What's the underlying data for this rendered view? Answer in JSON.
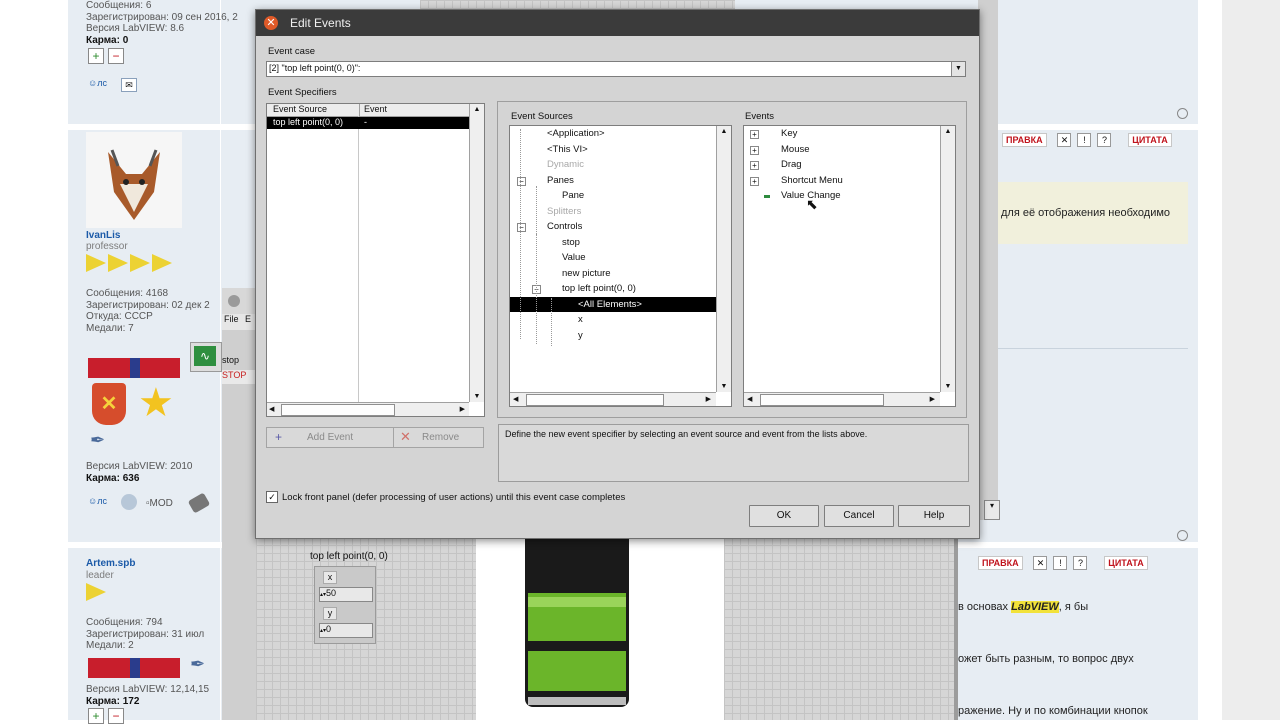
{
  "forum": {
    "post1": {
      "messages": "Сообщения: 6",
      "registered": "Зарегистрирован: 09 сен 2016, 2",
      "version": "Версия LabVIEW: 8.6",
      "karma_label": "Карма: ",
      "karma_value": "0"
    },
    "post2": {
      "username": "IvanLis",
      "rank": "professor",
      "messages": "Сообщения: 4168",
      "registered": "Зарегистрирован: 02 дек 2",
      "from": "Откуда: СССР",
      "medals": "Медали: 7",
      "version": "Версия LabVIEW: 2010",
      "karma_label": "Карма: ",
      "karma_value": "636",
      "right_text": "для её отображения необходимо",
      "mod_label": "MOD"
    },
    "post3": {
      "username": "Artem.spb",
      "rank": "leader",
      "messages": "Сообщения: 794",
      "registered": "Зарегистрирован: 31 июл",
      "medals": "Медали: 2",
      "version": "Версия LabVIEW: 12,14,15",
      "karma_label": "Карма: ",
      "karma_value": "172",
      "line1_pre": "в основах ",
      "line1_highlight": "LabVIEW",
      "line1_post": ", я бы",
      "line2": "ожет быть разным, то вопрос двух",
      "line3": "ражение. Ну и по комбинации кнопок"
    },
    "pm_label": "лс",
    "edit_label": "ПРАВКА",
    "quote_label": "ЦИТАТА"
  },
  "labview_bg": {
    "menu_file": "File",
    "menu_edit": "E",
    "stop_label": "stop",
    "stop_button": "STOP",
    "cluster_title": "top left point(0, 0)",
    "x_label": "x",
    "x_value": "50",
    "y_label": "y",
    "y_value": "0"
  },
  "dialog": {
    "title": "Edit Events",
    "event_case_label": "Event case",
    "event_case_value": "[2] \"top left point(0, 0)\":",
    "event_specifiers_label": "Event Specifiers",
    "col_event_source": "Event Source",
    "col_event": "Event",
    "specifier_row": {
      "source": "top left point(0, 0)",
      "event": "-"
    },
    "add_event": "Add Event",
    "remove": "Remove",
    "event_sources_label": "Event Sources",
    "events_label": "Events",
    "sources": [
      {
        "label": "<Application>",
        "indent": 1,
        "state": "normal"
      },
      {
        "label": "<This VI>",
        "indent": 1,
        "state": "normal"
      },
      {
        "label": "Dynamic",
        "indent": 1,
        "state": "dim"
      },
      {
        "label": "Panes",
        "indent": 1,
        "state": "normal",
        "exp": "−"
      },
      {
        "label": "Pane",
        "indent": 2,
        "state": "normal"
      },
      {
        "label": "Splitters",
        "indent": 1,
        "state": "dim"
      },
      {
        "label": "Controls",
        "indent": 1,
        "state": "normal",
        "exp": "−"
      },
      {
        "label": "stop",
        "indent": 2,
        "state": "normal"
      },
      {
        "label": "Value",
        "indent": 2,
        "state": "normal"
      },
      {
        "label": "new picture",
        "indent": 2,
        "state": "normal"
      },
      {
        "label": "top left point(0, 0)",
        "indent": 2,
        "state": "normal",
        "exp": "−"
      },
      {
        "label": "<All Elements>",
        "indent": 3,
        "state": "selected"
      },
      {
        "label": "x",
        "indent": 3,
        "state": "normal"
      },
      {
        "label": "y",
        "indent": 3,
        "state": "normal"
      }
    ],
    "events": [
      {
        "label": "Key",
        "exp": "+"
      },
      {
        "label": "Mouse",
        "exp": "+"
      },
      {
        "label": "Drag",
        "exp": "+"
      },
      {
        "label": "Shortcut Menu",
        "exp": "+"
      },
      {
        "label": "Value Change",
        "exp": "leaf"
      }
    ],
    "description": "Define the new event specifier by selecting an event source and event from the lists above.",
    "lock_label": "Lock front panel (defer processing of user actions) until this event case completes",
    "lock_checked": "✓",
    "ok": "OK",
    "cancel": "Cancel",
    "help": "Help"
  },
  "colors": {
    "accent_red": "#c0131c",
    "titlebar": "#3b3b3b",
    "gauge_green": "#6bb52a"
  }
}
